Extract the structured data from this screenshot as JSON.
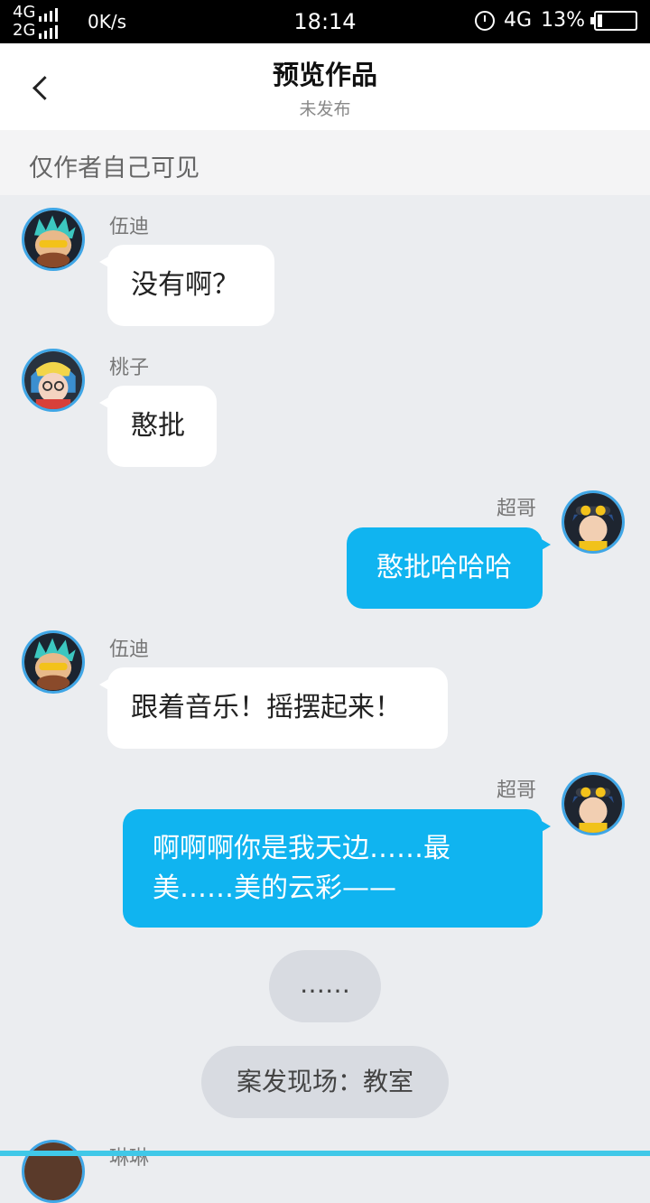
{
  "status": {
    "network_top": "4G",
    "network_bottom": "2G",
    "speed": "0K/s",
    "time": "18:14",
    "net_right": "4G",
    "battery": "13%",
    "battery_level": 0.13
  },
  "header": {
    "title": "预览作品",
    "subtitle": "未发布"
  },
  "notice": "仅作者自己可见",
  "messages": [
    {
      "name": "伍迪",
      "text": "没有啊？"
    },
    {
      "name": "桃子",
      "text": "憨批"
    },
    {
      "name": "超哥",
      "text": "憨批哈哈哈"
    },
    {
      "name": "伍迪",
      "text": "跟着音乐！摇摆起来！"
    },
    {
      "name": "超哥",
      "line1": "啊啊啊你是我天边……最",
      "line2": "美……美的云彩——"
    }
  ],
  "pills": {
    "ellipsis": "……",
    "scene": "案发现场：教室"
  },
  "partial_name": "琳琳"
}
